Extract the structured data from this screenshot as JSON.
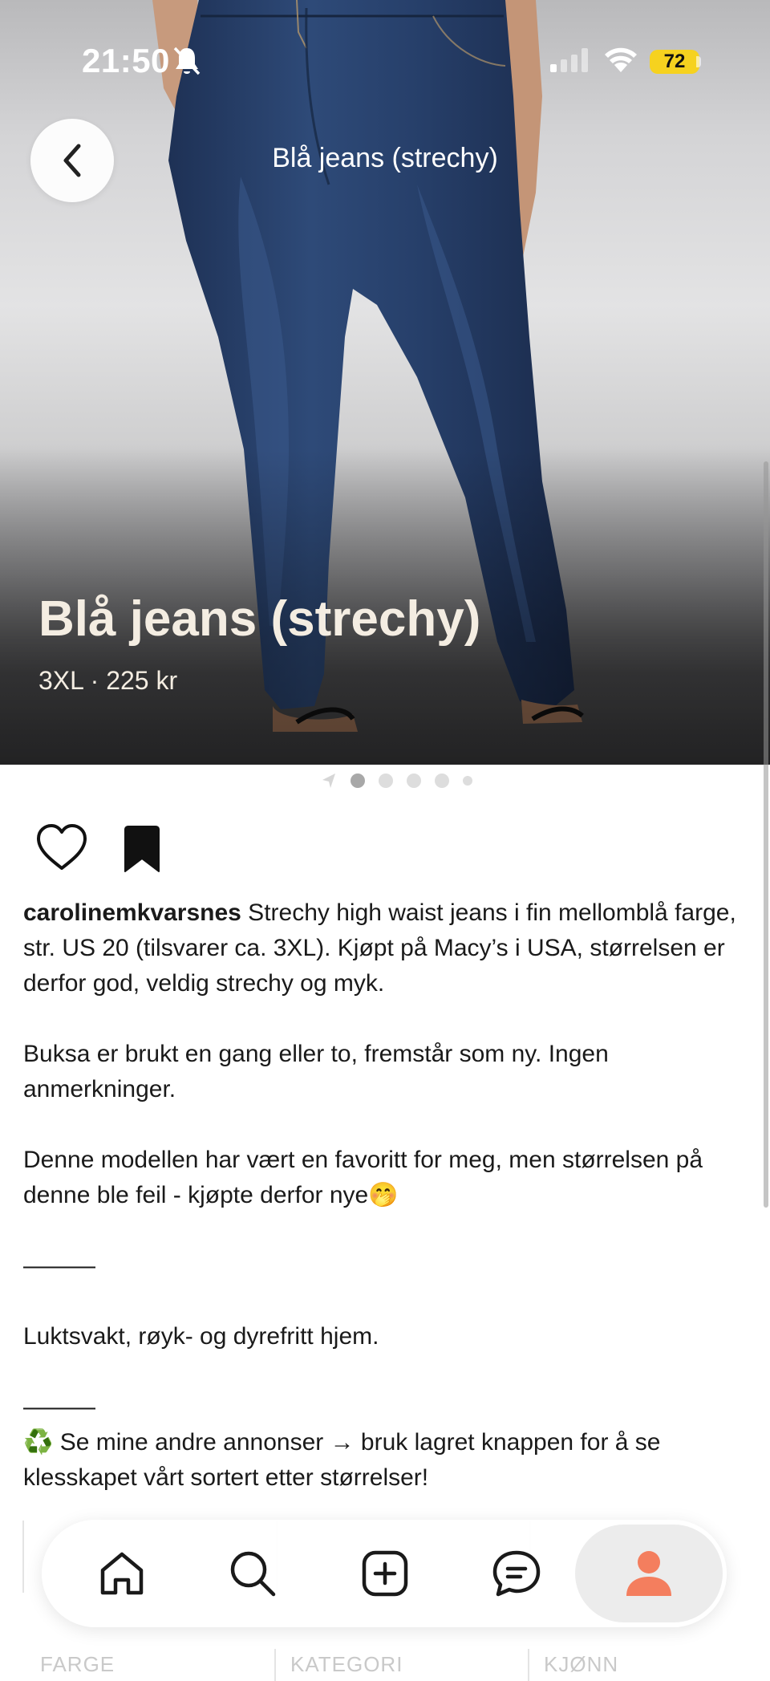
{
  "status_bar": {
    "time": "21:50",
    "battery": "72"
  },
  "nav": {
    "title": "Blå jeans (strechy)"
  },
  "hero": {
    "title": "Blå jeans (strechy)",
    "subtitle": "3XL · 225 kr"
  },
  "carousel": {
    "dot_count": 5,
    "active_index": 0
  },
  "description": {
    "username": "carolinemkvarsnes",
    "intro": " Strechy high waist jeans i fin mellomblå farge, str. US 20 (tilsvarer ca. 3XL). Kjøpt på Macy’s i USA, størrelsen er derfor god, veldig strechy og myk.",
    "p2": "Buksa er brukt en gang eller to, fremstår som ny. Ingen anmerkninger.",
    "p3": "Denne modellen har vært en favoritt for meg, men størrelsen på denne ble feil - kjøpte derfor nye🤭",
    "divider1": "———",
    "p4": "Luktsvakt, røyk- og dyrefritt hjem.",
    "divider2": "———",
    "p5": "♻️ Se mine andre annonser → bruk lagret knappen for å se klesskapet vårt sortert etter størrelser!"
  },
  "details_table": {
    "headers": [
      "FARGE",
      "KATEGORI",
      "KJØNN"
    ]
  },
  "tabbar": {
    "items": [
      "home-icon",
      "search-icon",
      "add-icon",
      "messages-icon",
      "profile-icon"
    ],
    "accent": "#f47e5e"
  }
}
